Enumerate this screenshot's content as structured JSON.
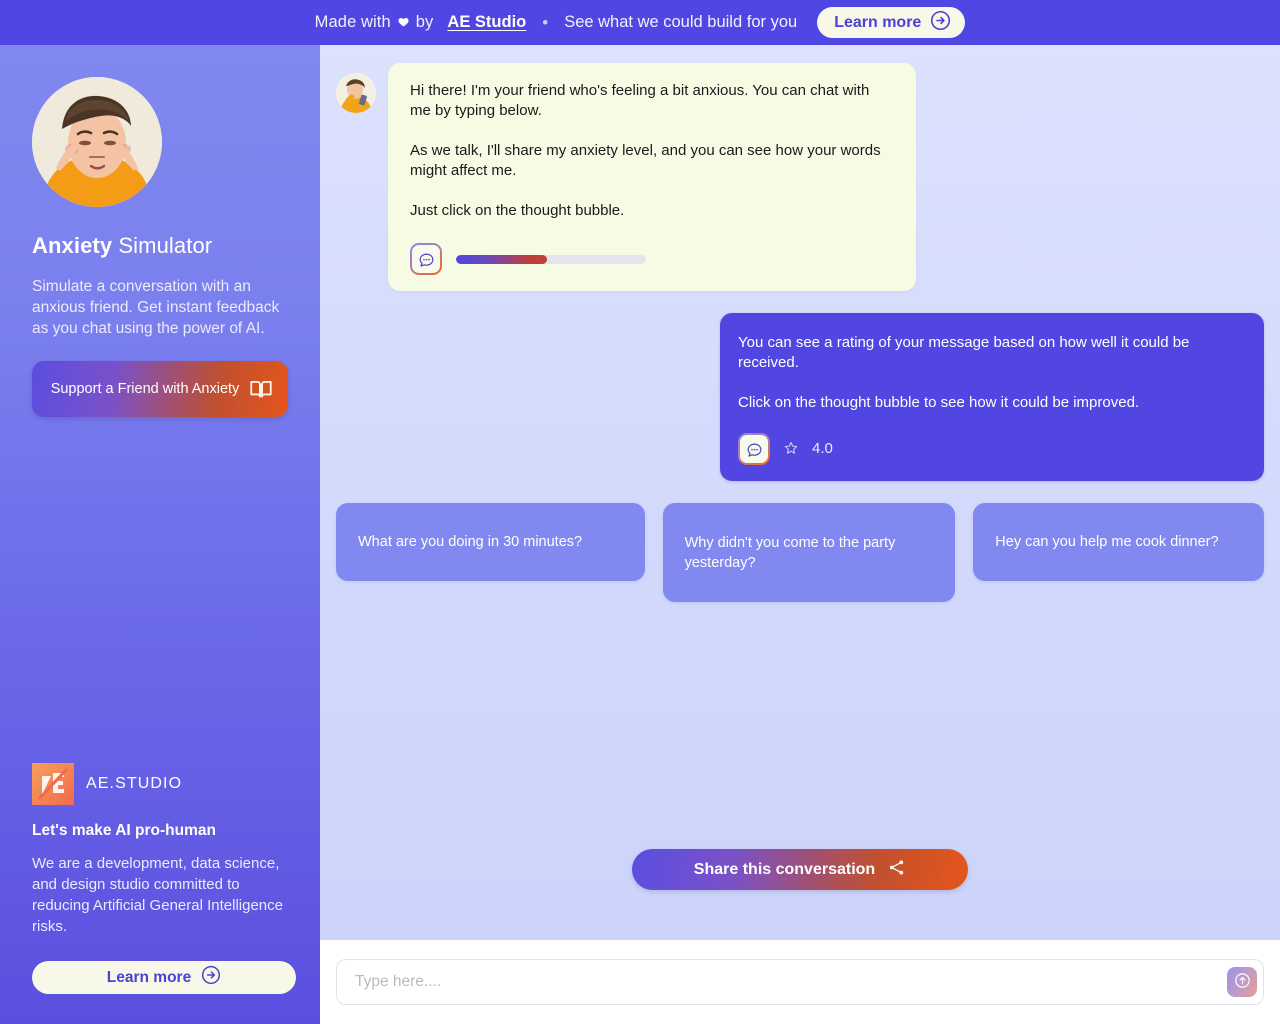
{
  "banner": {
    "made_with": "Made with",
    "heart_icon": "heart-icon",
    "by": "by",
    "studio_link": "AE Studio",
    "separator": "•",
    "tagline": "See what we could build for you",
    "learn_more": "Learn more",
    "learn_more_icon": "circle-arrow-right-icon"
  },
  "sidebar": {
    "avatar_icon": "anxious-person-avatar",
    "title_bold": "Anxiety",
    "title_rest": "Simulator",
    "description": "Simulate a conversation with an anxious friend. Get instant feedback as you chat using the power of AI.",
    "support_button": "Support a Friend with Anxiety",
    "support_button_icon": "book-icon",
    "brand": {
      "logo_icon": "ae-studio-logo",
      "name": "AE.STUDIO",
      "tagline": "Let's make AI pro-human",
      "description": "We are a development, data science, and design studio committed to reducing Artificial General Intelligence risks.",
      "learn_more": "Learn more",
      "learn_more_icon": "circle-arrow-right-icon"
    }
  },
  "chat": {
    "bot_avatar_icon": "friend-avatar",
    "bot_message": {
      "paragraphs": [
        "Hi there! I'm your friend who's feeling a bit anxious. You can chat with me by typing below.",
        "As we talk, I'll share my anxiety level, and you can see how your words might affect me.",
        "Just click on the thought bubble."
      ],
      "thought_bubble_icon": "thought-bubble-icon",
      "anxiety_level_percent": 48
    },
    "user_message": {
      "paragraphs": [
        "You can see a rating of your message based on how well it could be received.",
        "Click on the thought bubble to see how it could be improved."
      ],
      "thought_bubble_icon": "thought-bubble-icon",
      "star_icon": "star-outline-icon",
      "rating": "4.0"
    },
    "suggestions": [
      "What are you doing in 30 minutes?",
      "Why didn't you come to the party yesterday?",
      "Hey can you help me cook dinner?"
    ],
    "share_button": "Share this conversation",
    "share_button_icon": "share-icon"
  },
  "composer": {
    "placeholder": "Type here....",
    "value": "",
    "send_icon": "send-up-arrow-icon"
  },
  "colors": {
    "banner_bg": "#5046e4",
    "sidebar_top": "#8088ef",
    "sidebar_bottom": "#5a4fdf",
    "chat_bg": "#d6dcfc",
    "bot_bubble": "#f6fbe4",
    "user_bubble": "#5246e2",
    "suggestion_bg": "#8189f0",
    "accent_orange": "#e6551c",
    "accent_purple": "#5046e4",
    "cream": "#f7f8e8"
  }
}
